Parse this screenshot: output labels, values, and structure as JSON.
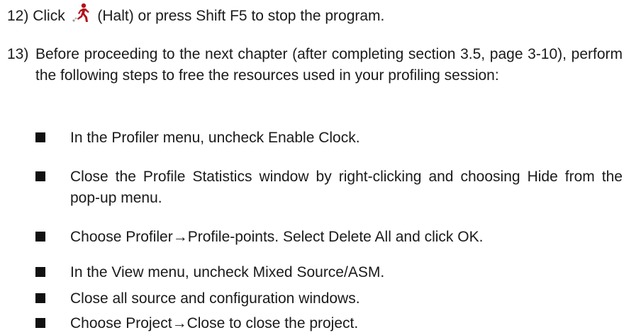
{
  "steps": [
    {
      "number": "12)",
      "before_icon": "Click",
      "icon": "halt-icon",
      "after_icon": "(Halt) or press Shift F5 to stop the program."
    },
    {
      "number": "13)",
      "text": "Before proceeding to the next chapter (after completing section 3.5, page 3-10), perform the following steps to free the resources used in your profiling session:"
    }
  ],
  "bullets": [
    "In the Profiler menu, uncheck Enable Clock.",
    "Close the Profile Statistics window by right-clicking and choosing Hide from the pop-up menu.",
    "Choose Profiler→Profile-points. Select Delete All and click OK.",
    "In the View menu, uncheck Mixed Source/ASM.",
    "Close all source and configuration windows.",
    "Choose Project→Close to close the project."
  ],
  "colors": {
    "text": "#1a1a1a",
    "bullet": "#111111",
    "icon_red": "#b3121b"
  }
}
